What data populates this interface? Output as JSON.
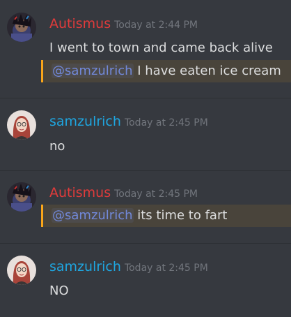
{
  "colors": {
    "background": "#36393f",
    "autismus_name": "#e03b3b",
    "samzulrich_name": "#1fa6e0",
    "mention": "#7289da",
    "highlight_bar": "#faa61a",
    "timestamp": "#72767d",
    "message_text": "#dcddde"
  },
  "groups": [
    {
      "username": "Autismus",
      "avatar_icon": "autismus-avatar-icon",
      "timestamp": "Today at 2:44 PM",
      "messages": [
        {
          "text": "I went to town and came back alive"
        },
        {
          "mention": "@samzulrich",
          "text": " I have eaten ice cream"
        }
      ]
    },
    {
      "username": "samzulrich",
      "avatar_icon": "samzulrich-avatar-icon",
      "timestamp": "Today at 2:45 PM",
      "messages": [
        {
          "text": "no"
        }
      ]
    },
    {
      "username": "Autismus",
      "avatar_icon": "autismus-avatar-icon",
      "timestamp": "Today at 2:45 PM",
      "messages": [
        {
          "mention": "@samzulrich",
          "text": " its time to fart"
        }
      ]
    },
    {
      "username": "samzulrich",
      "avatar_icon": "samzulrich-avatar-icon",
      "timestamp": "Today at 2:45 PM",
      "messages": [
        {
          "text": "NO"
        }
      ]
    }
  ]
}
